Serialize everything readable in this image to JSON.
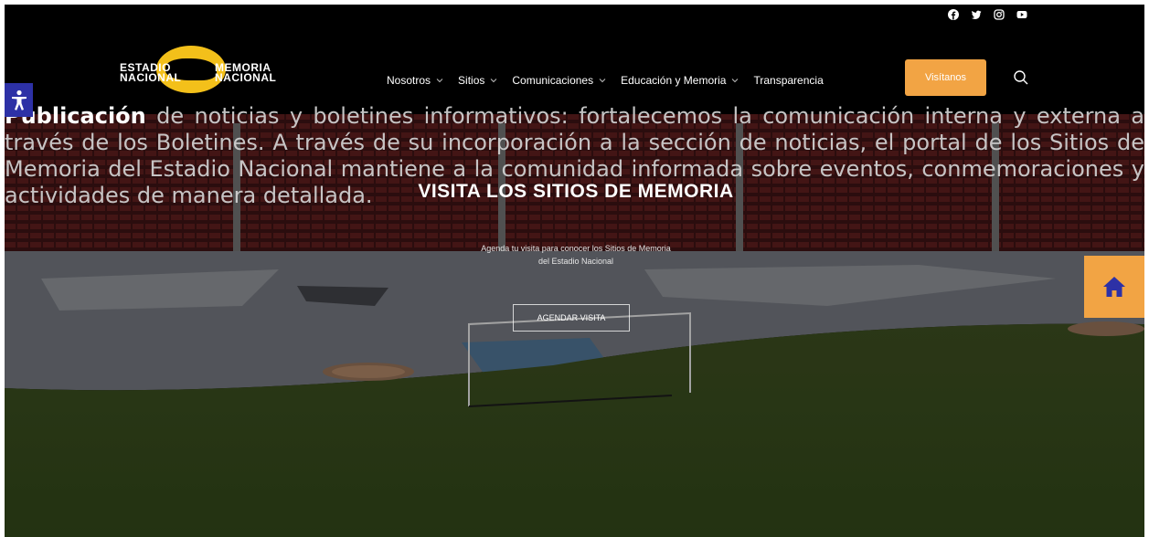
{
  "logo": {
    "line1_left": "ESTADIO",
    "line1_right": "MEMORIA",
    "line2_left": "NACIONAL",
    "line2_right": "NACIONAL"
  },
  "social": [
    "facebook-icon",
    "twitter-icon",
    "instagram-icon",
    "youtube-icon"
  ],
  "nav": {
    "items": [
      {
        "label": "Nosotros",
        "has_dropdown": true
      },
      {
        "label": "Sitios",
        "has_dropdown": true
      },
      {
        "label": "Comunicaciones",
        "has_dropdown": true
      },
      {
        "label": "Educación y Memoria",
        "has_dropdown": true
      },
      {
        "label": "Transparencia",
        "has_dropdown": false
      }
    ],
    "cta_label": "Visítanos",
    "search_icon": "search-icon"
  },
  "overlay": {
    "bold": "Publicación",
    "text": " de noticias y boletines informativos: fortalecemos la comunicación interna y externa a través de los Boletines. A través de su incorporación a la sección de noticias, el portal de los Sitios de Memoria del Estadio Nacional mantiene a la comunidad informada sobre eventos, conmemoraciones y actividades de manera detallada."
  },
  "hero": {
    "title": "VISITA LOS SITIOS DE MEMORIA",
    "subtitle_line1": "Agenda tu visita para conocer los Sitios de Memoria",
    "subtitle_line2": "del Estadio Nacional",
    "button_label": "AGENDAR VISITA"
  },
  "colors": {
    "accent": "#f2a444",
    "access_button": "#2d31a6",
    "header_bg": "#000000"
  }
}
